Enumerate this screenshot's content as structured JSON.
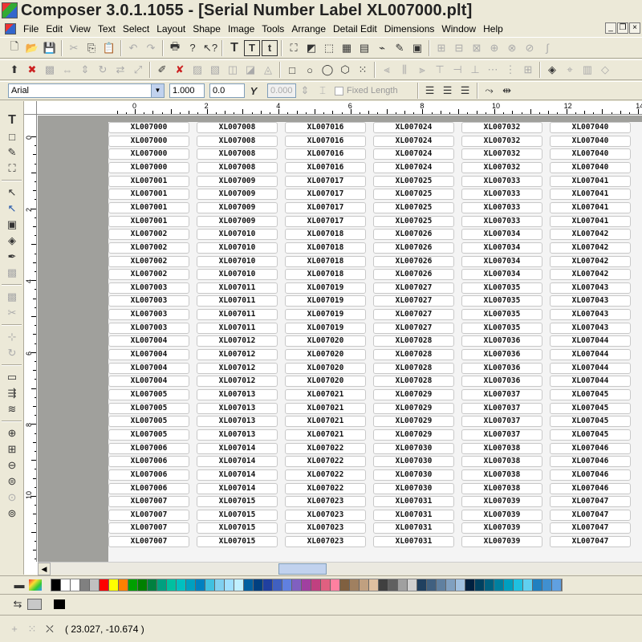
{
  "window": {
    "title": "Composer 3.0.1.1055 - [Serial Number Label XL007000.plt]"
  },
  "menu": [
    "File",
    "Edit",
    "View",
    "Text",
    "Select",
    "Layout",
    "Shape",
    "Image",
    "Tools",
    "Arrange",
    "Detail Edit",
    "Dimensions",
    "Window",
    "Help"
  ],
  "format_bar": {
    "font_name": "Arial",
    "size_value": "1.000",
    "angle_value": "0.0",
    "spacing_value": "0.000",
    "fixed_length_label": "Fixed Length"
  },
  "ruler": {
    "h_labels": [
      "0",
      "2",
      "4",
      "6",
      "8",
      "10",
      "12",
      "14"
    ],
    "v_labels": [
      "0",
      "2",
      "4",
      "6",
      "8",
      "10"
    ]
  },
  "labels": {
    "columns": [
      [
        "XL007000",
        "XL007000",
        "XL007000",
        "XL007000",
        "XL007001",
        "XL007001",
        "XL007001",
        "XL007001",
        "XL007002",
        "XL007002",
        "XL007002",
        "XL007002",
        "XL007003",
        "XL007003",
        "XL007003",
        "XL007003",
        "XL007004",
        "XL007004",
        "XL007004",
        "XL007004",
        "XL007005",
        "XL007005",
        "XL007005",
        "XL007005",
        "XL007006",
        "XL007006",
        "XL007006",
        "XL007006",
        "XL007007",
        "XL007007",
        "XL007007",
        "XL007007"
      ],
      [
        "XL007008",
        "XL007008",
        "XL007008",
        "XL007008",
        "XL007009",
        "XL007009",
        "XL007009",
        "XL007009",
        "XL007010",
        "XL007010",
        "XL007010",
        "XL007010",
        "XL007011",
        "XL007011",
        "XL007011",
        "XL007011",
        "XL007012",
        "XL007012",
        "XL007012",
        "XL007012",
        "XL007013",
        "XL007013",
        "XL007013",
        "XL007013",
        "XL007014",
        "XL007014",
        "XL007014",
        "XL007014",
        "XL007015",
        "XL007015",
        "XL007015",
        "XL007015"
      ],
      [
        "XL007016",
        "XL007016",
        "XL007016",
        "XL007016",
        "XL007017",
        "XL007017",
        "XL007017",
        "XL007017",
        "XL007018",
        "XL007018",
        "XL007018",
        "XL007018",
        "XL007019",
        "XL007019",
        "XL007019",
        "XL007019",
        "XL007020",
        "XL007020",
        "XL007020",
        "XL007020",
        "XL007021",
        "XL007021",
        "XL007021",
        "XL007021",
        "XL007022",
        "XL007022",
        "XL007022",
        "XL007022",
        "XL007023",
        "XL007023",
        "XL007023",
        "XL007023"
      ],
      [
        "XL007024",
        "XL007024",
        "XL007024",
        "XL007024",
        "XL007025",
        "XL007025",
        "XL007025",
        "XL007025",
        "XL007026",
        "XL007026",
        "XL007026",
        "XL007026",
        "XL007027",
        "XL007027",
        "XL007027",
        "XL007027",
        "XL007028",
        "XL007028",
        "XL007028",
        "XL007028",
        "XL007029",
        "XL007029",
        "XL007029",
        "XL007029",
        "XL007030",
        "XL007030",
        "XL007030",
        "XL007030",
        "XL007031",
        "XL007031",
        "XL007031",
        "XL007031"
      ],
      [
        "XL007032",
        "XL007032",
        "XL007032",
        "XL007032",
        "XL007033",
        "XL007033",
        "XL007033",
        "XL007033",
        "XL007034",
        "XL007034",
        "XL007034",
        "XL007034",
        "XL007035",
        "XL007035",
        "XL007035",
        "XL007035",
        "XL007036",
        "XL007036",
        "XL007036",
        "XL007036",
        "XL007037",
        "XL007037",
        "XL007037",
        "XL007037",
        "XL007038",
        "XL007038",
        "XL007038",
        "XL007038",
        "XL007039",
        "XL007039",
        "XL007039",
        "XL007039"
      ],
      [
        "XL007040",
        "XL007040",
        "XL007040",
        "XL007040",
        "XL007041",
        "XL007041",
        "XL007041",
        "XL007041",
        "XL007042",
        "XL007042",
        "XL007042",
        "XL007042",
        "XL007043",
        "XL007043",
        "XL007043",
        "XL007043",
        "XL007044",
        "XL007044",
        "XL007044",
        "XL007044",
        "XL007045",
        "XL007045",
        "XL007045",
        "XL007045",
        "XL007046",
        "XL007046",
        "XL007046",
        "XL007046",
        "XL007047",
        "XL007047",
        "XL007047",
        "XL007047"
      ]
    ]
  },
  "palette": [
    "#000000",
    "#ffffff",
    "#ffffff",
    "#808080",
    "#c0c0c0",
    "#ff0000",
    "#ffff00",
    "#ff8000",
    "#00a000",
    "#008000",
    "#008040",
    "#00a080",
    "#00c0a0",
    "#00c0c0",
    "#00a0c0",
    "#0080c0",
    "#40c0e0",
    "#80d0f0",
    "#a0e0ff",
    "#c0f0ff",
    "#0060a0",
    "#004080",
    "#2040a0",
    "#4060c0",
    "#6080e0",
    "#8060c0",
    "#a040a0",
    "#c04080",
    "#e06080",
    "#ff80a0",
    "#806040",
    "#a08060",
    "#c0a080",
    "#e0c0a0",
    "#404040",
    "#606060",
    "#a0a0a0",
    "#d0d0d0",
    "#204060",
    "#406080",
    "#6080a0",
    "#80a0c0",
    "#a0c0e0",
    "#002040",
    "#004060",
    "#006080",
    "#0080a0",
    "#00a0c0",
    "#20c0e0",
    "#60d0f0",
    "#2080c0",
    "#4090d0",
    "#60a0e0"
  ],
  "status": {
    "coordinates": "( 23.027, -10.674 )"
  }
}
